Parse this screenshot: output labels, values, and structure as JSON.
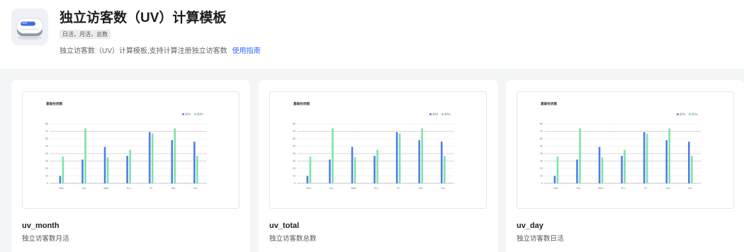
{
  "header": {
    "icon": "template-icon",
    "title": "独立访客数（UV）计算模板",
    "tag": "日活，月活，总数",
    "description": "独立访客数（UV）计算模板,支持计算注册独立访客数",
    "guide_link": "使用指南"
  },
  "colors": {
    "link": "#2f6bff",
    "series_blue": "#4f7ee8",
    "series_green": "#7ee2a8",
    "background": "#f4f5f6"
  },
  "cards": [
    {
      "name": "uv_month",
      "desc": "独立访客数月活"
    },
    {
      "name": "uv_total",
      "desc": "独立访客数总数"
    },
    {
      "name": "uv_day",
      "desc": "独立访客数日活"
    }
  ],
  "chart_data": [
    {
      "type": "bar",
      "title": "基础柱状图",
      "categories": [
        "Mon",
        "Tue",
        "Wed",
        "Thu",
        "Fri",
        "Sat",
        "Sun"
      ],
      "series": [
        {
          "name": "系列1",
          "color": "#4f7ee8",
          "values": [
            10,
            32,
            49,
            37,
            69,
            58,
            56
          ]
        },
        {
          "name": "系列2",
          "color": "#7ee2a8",
          "values": [
            36,
            74,
            35,
            45,
            67,
            74,
            37
          ]
        }
      ],
      "ylim": [
        0,
        80
      ],
      "yticks": [
        "0",
        "10",
        "20",
        "30",
        "40",
        "50",
        "60",
        "70",
        "80"
      ],
      "grid": true,
      "legend": "top-right"
    },
    {
      "type": "bar",
      "title": "基础柱状图",
      "categories": [
        "Mon",
        "Tue",
        "Wed",
        "Thu",
        "Fri",
        "Sat",
        "Sun"
      ],
      "series": [
        {
          "name": "系列1",
          "color": "#4f7ee8",
          "values": [
            10,
            32,
            49,
            37,
            69,
            58,
            56
          ]
        },
        {
          "name": "系列2",
          "color": "#7ee2a8",
          "values": [
            36,
            74,
            35,
            45,
            67,
            74,
            37
          ]
        }
      ],
      "ylim": [
        0,
        80
      ],
      "yticks": [
        "0",
        "10",
        "20",
        "30",
        "40",
        "50",
        "60",
        "70",
        "80"
      ],
      "grid": true,
      "legend": "top-right"
    },
    {
      "type": "bar",
      "title": "基础柱状图",
      "categories": [
        "Mon",
        "Tue",
        "Wed",
        "Thu",
        "Fri",
        "Sat",
        "Sun"
      ],
      "series": [
        {
          "name": "系列1",
          "color": "#4f7ee8",
          "values": [
            10,
            32,
            49,
            37,
            69,
            58,
            56
          ]
        },
        {
          "name": "系列2",
          "color": "#7ee2a8",
          "values": [
            36,
            74,
            35,
            45,
            67,
            74,
            37
          ]
        }
      ],
      "ylim": [
        0,
        80
      ],
      "yticks": [
        "0",
        "10",
        "20",
        "30",
        "40",
        "50",
        "60",
        "70",
        "80"
      ],
      "grid": true,
      "legend": "top-right"
    }
  ]
}
